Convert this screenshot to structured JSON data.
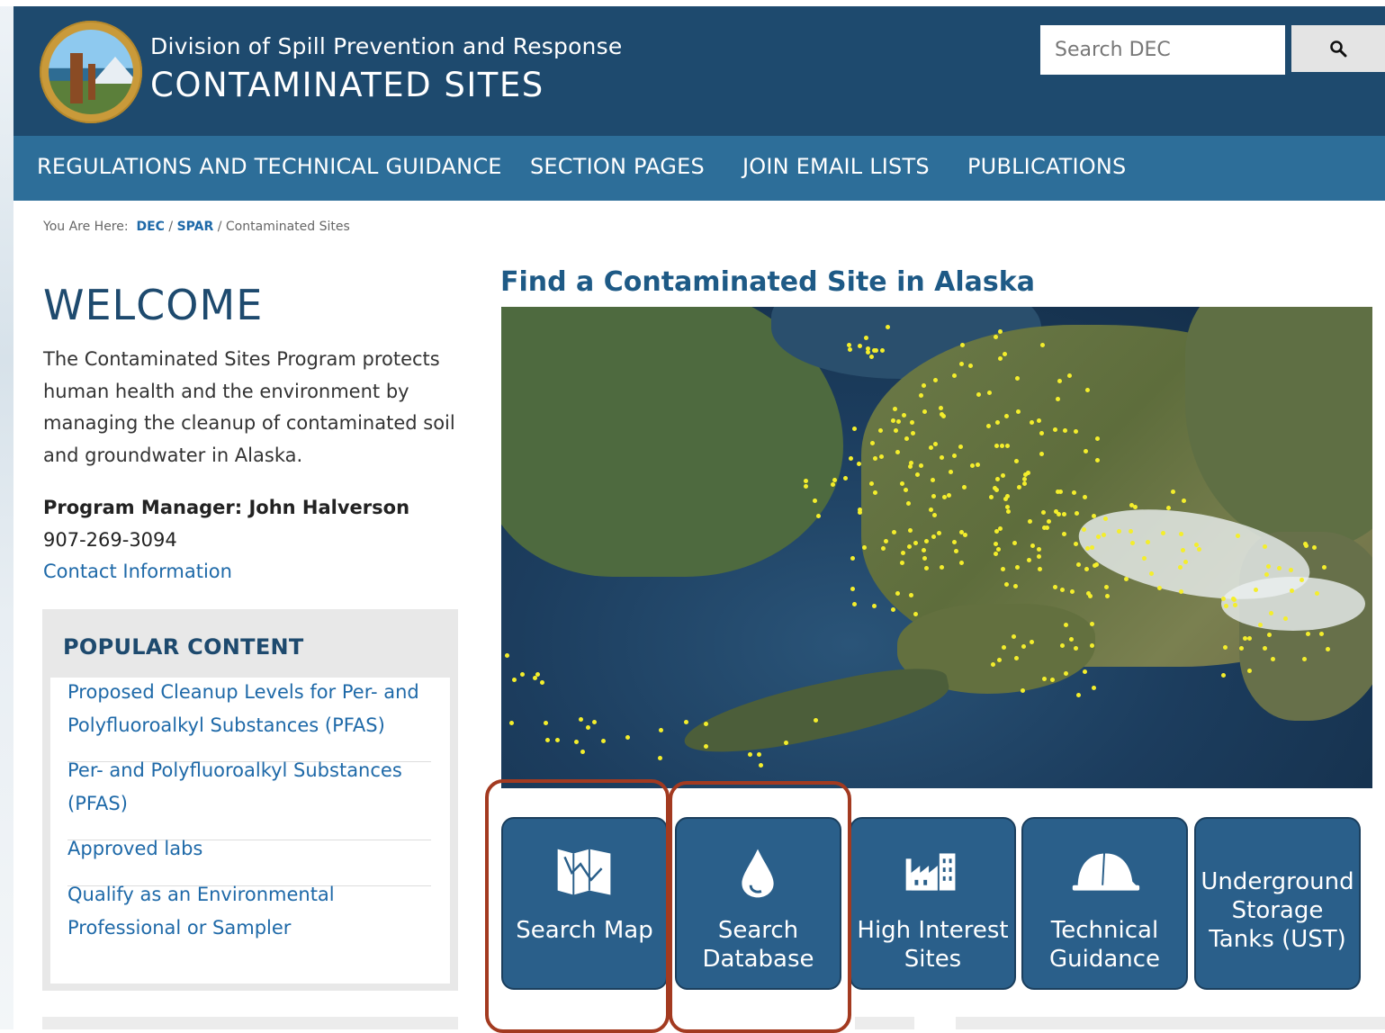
{
  "header": {
    "division": "Division of Spill Prevention and Response",
    "program": "CONTAMINATED SITES",
    "search_placeholder": "Search DEC"
  },
  "nav": {
    "items": [
      {
        "label": "REGULATIONS AND TECHNICAL GUIDANCE"
      },
      {
        "label": "SECTION PAGES"
      },
      {
        "label": "JOIN EMAIL LISTS"
      },
      {
        "label": "PUBLICATIONS"
      }
    ]
  },
  "breadcrumb": {
    "prefix": "You Are Here:",
    "links": [
      "DEC",
      "SPAR"
    ],
    "current": "Contaminated Sites",
    "separator": "/"
  },
  "welcome": {
    "heading": "WELCOME",
    "body": "The Contaminated Sites Program protects human health and the environment by managing the cleanup of contaminated soil and groundwater in Alaska.",
    "manager_label": "Program Manager: John Halverson",
    "phone": "907-269-3094",
    "contact_link": "Contact Information"
  },
  "popular": {
    "title": "POPULAR CONTENT",
    "items": [
      {
        "label": "Proposed Cleanup Levels for Per- and Polyfluoroalkyl Substances (PFAS)"
      },
      {
        "label": "Per- and Polyfluoroalkyl Substances (PFAS)"
      },
      {
        "label": "Approved labs"
      },
      {
        "label": "Qualify as an Environmental Professional or Sampler"
      }
    ]
  },
  "map_section": {
    "title": "Find a Contaminated Site in Alaska"
  },
  "tiles": [
    {
      "label": "Search Map",
      "icon": "map-icon",
      "highlighted": true
    },
    {
      "label": "Search Database",
      "icon": "droplet-icon",
      "highlighted": true
    },
    {
      "label": "High Interest Sites",
      "icon": "factory-icon",
      "highlighted": false
    },
    {
      "label": "Technical Guidance",
      "icon": "hardhat-icon",
      "highlighted": false
    },
    {
      "label": "Underground Storage Tanks (UST)",
      "icon": "none",
      "highlighted": false
    }
  ],
  "colors": {
    "header_bg": "#1e4a6e",
    "nav_bg": "#2d6e99",
    "tile_bg": "#2a5f8a",
    "link": "#1e69a8",
    "highlight_box": "#a33a20",
    "site_marker": "#f4ee2c"
  }
}
